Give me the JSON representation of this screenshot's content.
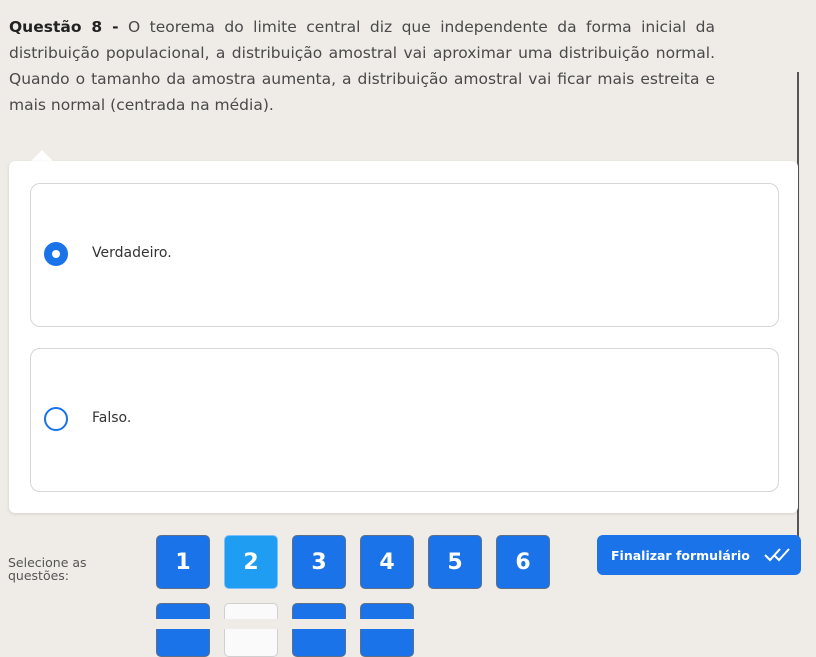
{
  "question": {
    "label": "Questão 8 -",
    "text": " O teorema do limite central diz que independente da forma inicial da distribuição populacional, a distribuição amostral vai aproximar uma distribuição normal. Quando o tamanho da amostra aumenta, a distribuição amostral vai ficar mais estreita e mais normal (centrada na média)."
  },
  "options": [
    {
      "label": "Verdadeiro.",
      "selected": true
    },
    {
      "label": "Falso.",
      "selected": false
    }
  ],
  "navigation": {
    "select_label": "Selecione as questões:",
    "buttons": [
      "1",
      "2",
      "3",
      "4",
      "5",
      "6"
    ],
    "active": "2"
  },
  "finalize": {
    "label": "Finalizar formulário",
    "icon": "double-check-icon"
  }
}
